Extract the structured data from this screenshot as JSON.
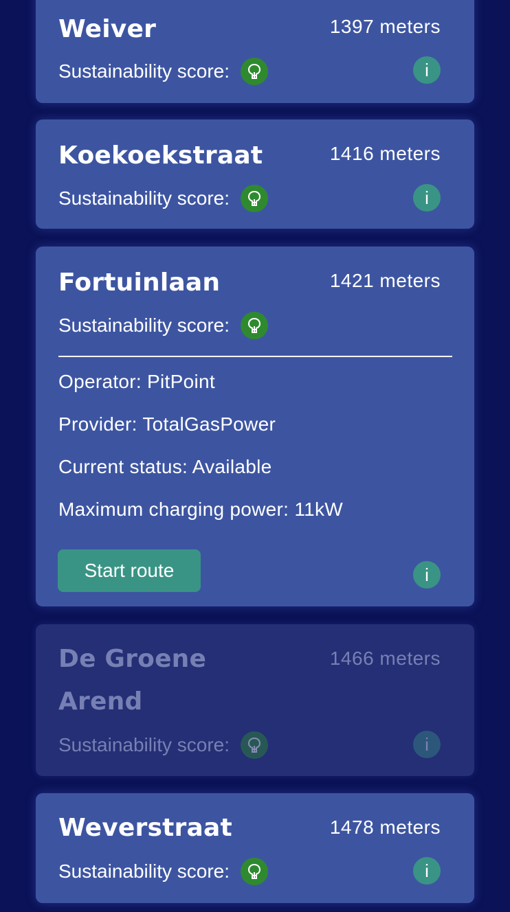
{
  "score_label": "Sustainability score:",
  "info_label": "i",
  "stations": [
    {
      "name_lines": [
        "Weiver"
      ],
      "distance": "1397 meters"
    },
    {
      "name_lines": [
        "Koekoekstraat"
      ],
      "distance": "1416 meters"
    },
    {
      "name_lines": [
        "Fortuinlaan"
      ],
      "distance": "1421 meters",
      "details": {
        "operator": "Operator: PitPoint",
        "provider": "Provider: TotalGasPower",
        "status": "Current status: Available",
        "power": "Maximum charging power: 11kW"
      },
      "route_button": "Start route"
    },
    {
      "name_lines": [
        "De Groene",
        "Arend"
      ],
      "distance": "1466 meters",
      "disabled": true
    },
    {
      "name_lines": [
        "Weverstraat"
      ],
      "distance": "1478 meters"
    }
  ],
  "colors": {
    "background": "#0b1257",
    "card": "#3d55a1",
    "card_disabled": "#242f75",
    "score_badge": "#2f8a2f",
    "accent_teal": "#3a9485"
  },
  "icons": {
    "score": "tree-icon",
    "info": "info-icon"
  }
}
